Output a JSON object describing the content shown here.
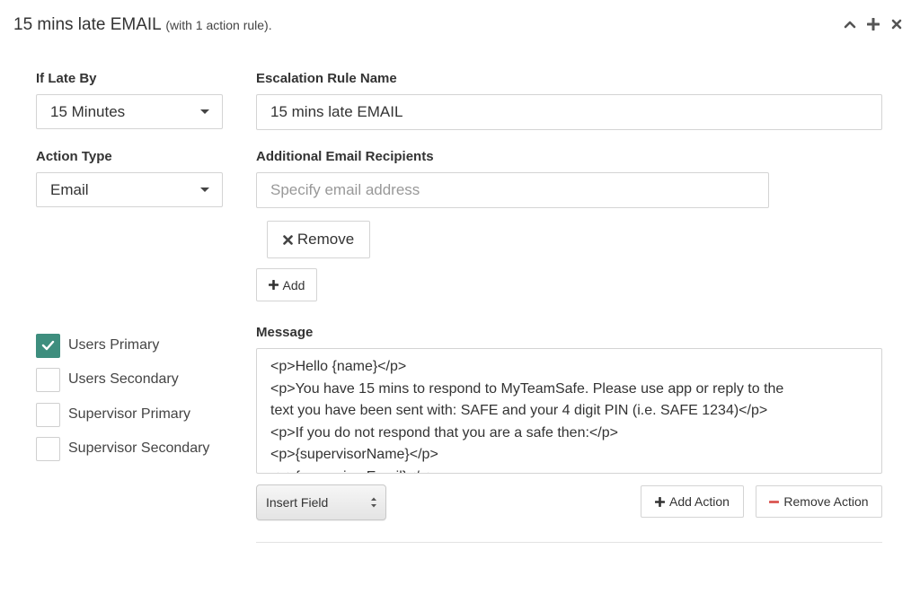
{
  "header": {
    "title": "15 mins late EMAIL",
    "subtitle": "(with 1 action rule)."
  },
  "icons": {
    "collapse": "chevron-up-icon",
    "add": "plus-icon",
    "close": "close-icon"
  },
  "late_by": {
    "label": "If Late By",
    "value": "15 Minutes"
  },
  "rule_name": {
    "label": "Escalation Rule Name",
    "value": "15 mins late EMAIL"
  },
  "action_type": {
    "label": "Action Type",
    "value": "Email"
  },
  "recipients": {
    "label": "Additional Email Recipients",
    "placeholder": "Specify email address",
    "remove_label": "Remove",
    "add_label": "Add"
  },
  "targets": [
    {
      "label": "Users Primary",
      "checked": true
    },
    {
      "label": "Users Secondary",
      "checked": false
    },
    {
      "label": "Supervisor Primary",
      "checked": false
    },
    {
      "label": "Supervisor Secondary",
      "checked": false
    }
  ],
  "message": {
    "label": "Message",
    "lines": [
      "<p>Hello {name}</p>",
      "<p>You have 15 mins to respond to MyTeamSafe. Please use app or reply to the",
      "text you have been sent with: SAFE and your 4 digit PIN (i.e. SAFE 1234)</p>",
      "<p>If you do not respond that you are a safe then:</p>",
      "<p>{supervisorName}</p>",
      "<p>{supervisorEmail}</p>"
    ]
  },
  "footer": {
    "insert_field": "Insert Field",
    "add_action": "Add Action",
    "remove_action": "Remove Action"
  },
  "colors": {
    "accent": "#3e8e7e",
    "danger": "#d9534f",
    "border": "#d4d4d4"
  }
}
